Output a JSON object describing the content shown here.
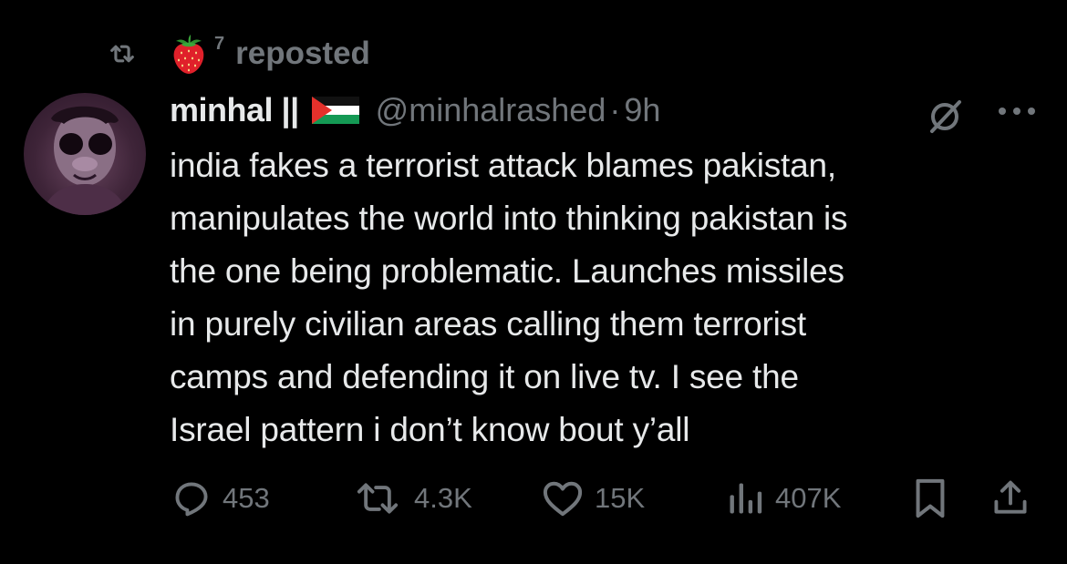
{
  "repost_bar": {
    "icon": "repost-icon",
    "avatar_icon": "strawberry-emoji",
    "superscript": "7",
    "label": "reposted"
  },
  "tweet": {
    "avatar_icon": "user-avatar",
    "display_name": "minhal ||",
    "flag_icon": "palestine-flag",
    "handle": "@minhalrashed",
    "separator": "·",
    "time": "9h",
    "text_lines": [
      "india fakes a terrorist attack blames pakistan,",
      "manipulates the world into thinking pakistan is",
      "the one being problematic. Launches missiles",
      "in purely civilian areas calling them terrorist",
      "camps and defending it on live tv. I see the",
      "Israel pattern i don’t know bout y’all"
    ]
  },
  "actions": {
    "replies": "453",
    "reposts": "4.3K",
    "likes": "15K",
    "views": "407K"
  },
  "colors": {
    "background": "#000000",
    "text": "#e7e9ea",
    "muted": "#71767b"
  }
}
